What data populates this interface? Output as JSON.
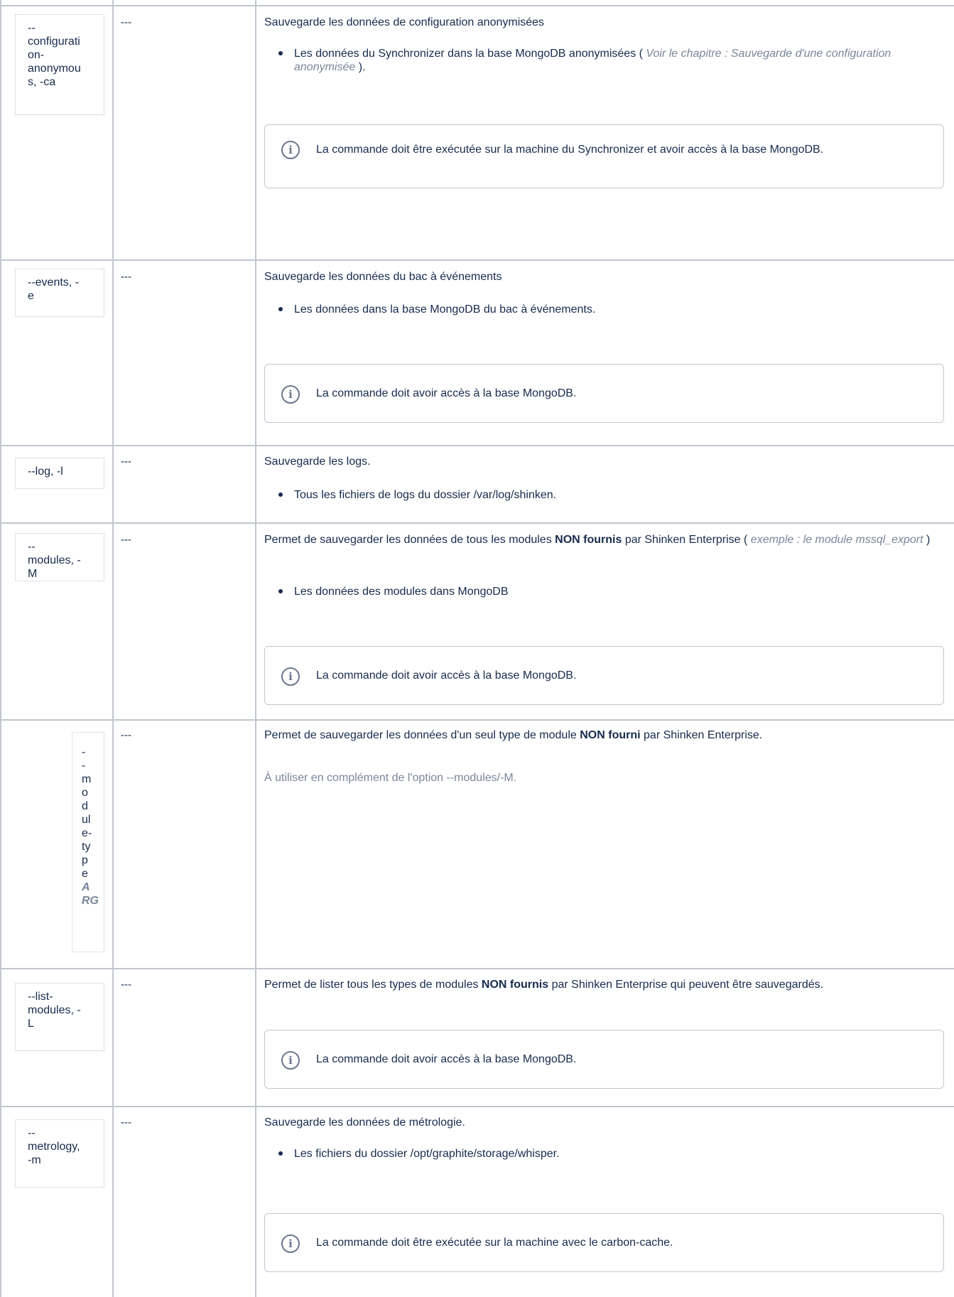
{
  "rows": [
    {
      "option_lines": [
        "--",
        "configurati",
        "on-",
        "anonymou",
        "s, -ca"
      ],
      "default": "---",
      "description": "Sauvegarde les données de configuration anonymisées",
      "bullet": "Les données du Synchronizer dans la base MongoDB anonymisées (",
      "bullet_link": "Voir le chapitre : Sauvegarde d'une configuration anonymisée",
      "bullet_end": ").",
      "info": "La commande doit être exécutée sur la machine du Synchronizer et avoir accès à la base MongoDB."
    },
    {
      "option_lines": [
        "--events, -",
        "e"
      ],
      "default": "---",
      "description": "Sauvegarde les données du bac à événements",
      "bullet": "Les données dans la base MongoDB du bac à événements.",
      "info": "La commande doit avoir accès à la base MongoDB."
    },
    {
      "option_lines": [
        "--log, -l"
      ],
      "default": "---",
      "description": "Sauvegarde les logs.",
      "bullet": "Tous les fichiers de logs du dossier /var/log/shinken."
    },
    {
      "option_lines": [
        "--",
        "modules, -",
        "M"
      ],
      "default": "---",
      "description_prefix": "Permet de sauvegarder les données de tous les modules ",
      "description_bold": "NON fournis",
      "description_suffix": " par Shinken Enterprise (",
      "description_example": "exemple : le module mssql_export",
      "description_end": ")",
      "bullet": "Les données des modules dans MongoDB",
      "info": "La commande doit avoir accès à la base MongoDB."
    },
    {
      "option_lines": [
        "-",
        "-",
        "m",
        "o",
        "d",
        "ul",
        "e-",
        "ty",
        "p",
        "e"
      ],
      "option_arg_lines": [
        "A",
        "RG"
      ],
      "default": "---",
      "description_prefix": "Permet de sauvegarder les données d'un seul type de module ",
      "description_bold": "NON fourni",
      "description_suffix": " par Shinken Enterprise.",
      "note": "À utiliser en complément de l'option --modules/-M."
    },
    {
      "option_lines": [
        "--list-",
        "modules, -",
        "L"
      ],
      "default": "---",
      "description_prefix": "Permet de lister tous les types de modules ",
      "description_bold": "NON fournis",
      "description_suffix": " par Shinken Enterprise qui peuvent être sauvegardés.",
      "info": "La commande doit avoir accès à la base MongoDB."
    },
    {
      "option_lines": [
        "--",
        "metrology,",
        "-m"
      ],
      "default": "---",
      "description": "Sauvegarde les données de métrologie.",
      "bullet": "Les fichiers du dossier /opt/graphite/storage/whisper.",
      "info": "La commande doit être exécutée sur la machine avec le carbon-cache."
    }
  ],
  "icons": {
    "info": "info-icon"
  },
  "colors": {
    "border": "#c1c7d0",
    "muted": "#7a869a",
    "text": "#172b4d"
  }
}
